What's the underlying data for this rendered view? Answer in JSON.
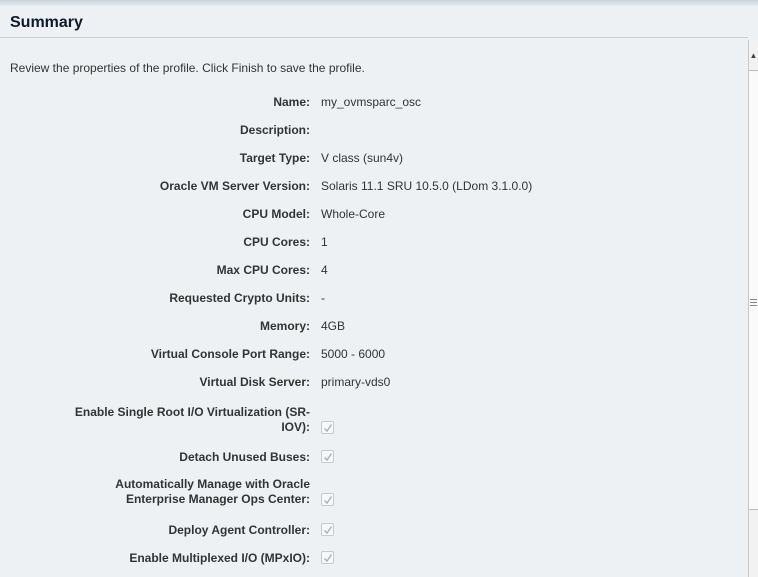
{
  "header": {
    "title": "Summary"
  },
  "intro": "Review the properties of the profile. Click Finish to save the profile.",
  "fields": [
    {
      "label": "Name:",
      "value": "my_ovmsparc_osc"
    },
    {
      "label": "Description:",
      "value": ""
    },
    {
      "label": "Target Type:",
      "value": "V class (sun4v)"
    },
    {
      "label": "Oracle VM Server Version:",
      "value": "Solaris 11.1 SRU 10.5.0 (LDom 3.1.0.0)"
    },
    {
      "label": "CPU Model:",
      "value": "Whole-Core"
    },
    {
      "label": "CPU Cores:",
      "value": "1"
    },
    {
      "label": "Max CPU Cores:",
      "value": "4"
    },
    {
      "label": "Requested Crypto Units:",
      "value": "-"
    },
    {
      "label": "Memory:",
      "value": "4GB"
    },
    {
      "label": "Virtual Console Port Range:",
      "value": "5000 - 6000"
    },
    {
      "label": "Virtual Disk Server:",
      "value": "primary-vds0"
    }
  ],
  "options": [
    {
      "label_line1": "Enable Single Root I/O Virtualization (SR-",
      "label_line2": "IOV):",
      "checked": true
    },
    {
      "label_line1": "",
      "label_line2": "Detach Unused Buses:",
      "checked": true
    },
    {
      "label_line1": "Automatically Manage with Oracle",
      "label_line2": "Enterprise Manager Ops Center:",
      "checked": true
    },
    {
      "label_line1": "",
      "label_line2": "Deploy Agent Controller:",
      "checked": true
    },
    {
      "label_line1": "",
      "label_line2": "Enable Multiplexed I/O (MPxIO):",
      "checked": true
    }
  ],
  "colors": {
    "background": "#eef1f4",
    "text": "#333333",
    "title": "#0b1b2b",
    "check": "#a9b0b6"
  },
  "icons": {
    "scroll_up": "scroll-up-arrow-icon",
    "check": "checkmark-icon"
  }
}
